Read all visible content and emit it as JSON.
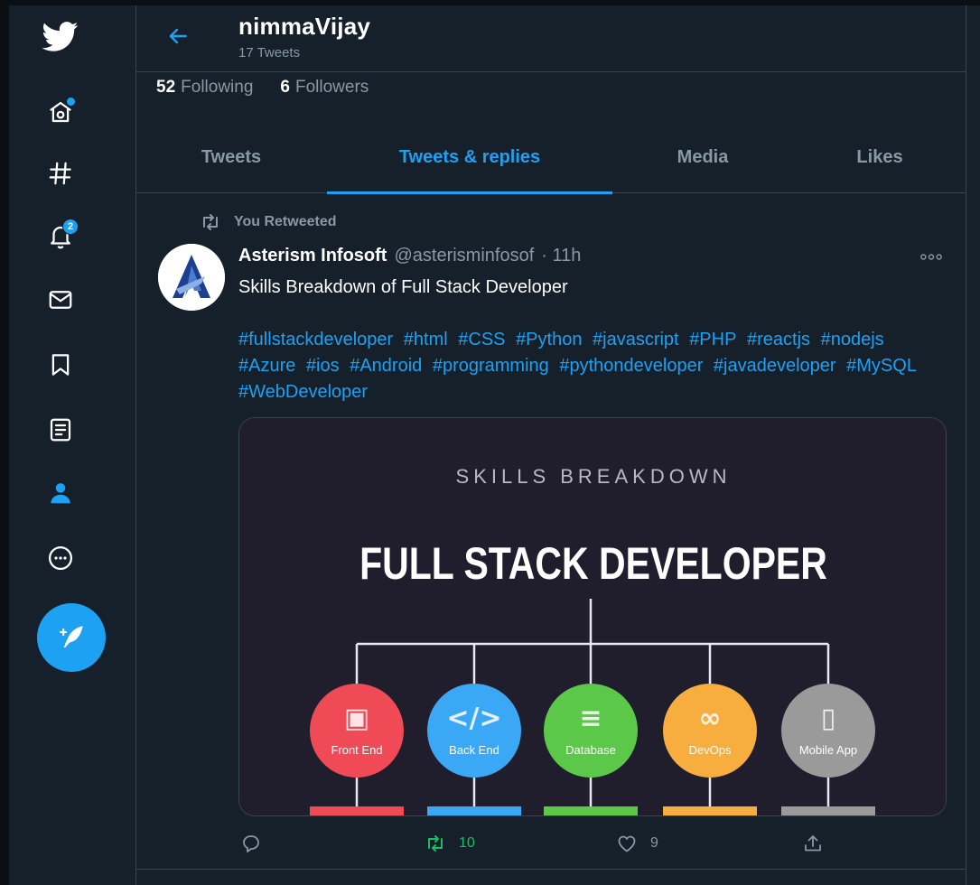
{
  "profile": {
    "name": "nimmaVijay",
    "tweet_count": "17 Tweets",
    "following_count": "52",
    "following_label": "Following",
    "followers_count": "6",
    "followers_label": "Followers"
  },
  "nav": {
    "notification_badge": "2",
    "icons": [
      "twitter-logo-icon",
      "home-icon",
      "explore-hashtag-icon",
      "notifications-bell-icon",
      "messages-envelope-icon",
      "bookmarks-icon",
      "lists-icon",
      "profile-icon",
      "more-icon",
      "compose-tweet-icon"
    ]
  },
  "tabs": [
    {
      "label": "Tweets"
    },
    {
      "label": "Tweets & replies",
      "active": true
    },
    {
      "label": "Media"
    },
    {
      "label": "Likes"
    }
  ],
  "tweet": {
    "retweet_context": "You Retweeted",
    "author": "Asterism Infosoft",
    "handle": "@asterisminfosof",
    "time": "· 11h",
    "text": "Skills Breakdown of Full Stack Developer",
    "hashtags": [
      "#fullstackdeveloper",
      "#html",
      "#CSS",
      "#Python",
      "#javascript",
      "#PHP",
      "#reactjs",
      "#nodejs",
      "#Azure",
      "#ios",
      "#Android",
      "#programming",
      "#pythondeveloper",
      "#javadeveloper",
      "#MySQL",
      "#WebDeveloper"
    ],
    "media": {
      "subtitle": "SKILLS BREAKDOWN",
      "title": "FULL STACK DEVELOPER",
      "nodes": [
        {
          "label": "Front End",
          "color": "#ef4a56"
        },
        {
          "label": "Back End",
          "color": "#3ba8f5"
        },
        {
          "label": "Database",
          "color": "#5cc84a"
        },
        {
          "label": "DevOps",
          "color": "#f8ad3f"
        },
        {
          "label": "Mobile App",
          "color": "#9a9a9a"
        }
      ]
    },
    "actions": {
      "retweets": "10",
      "likes": "9"
    }
  },
  "colors": {
    "background": "#15202b",
    "accent": "#1da1f2",
    "muted": "#8899a6",
    "border": "#38444d",
    "retweet_green": "#17bf63"
  }
}
